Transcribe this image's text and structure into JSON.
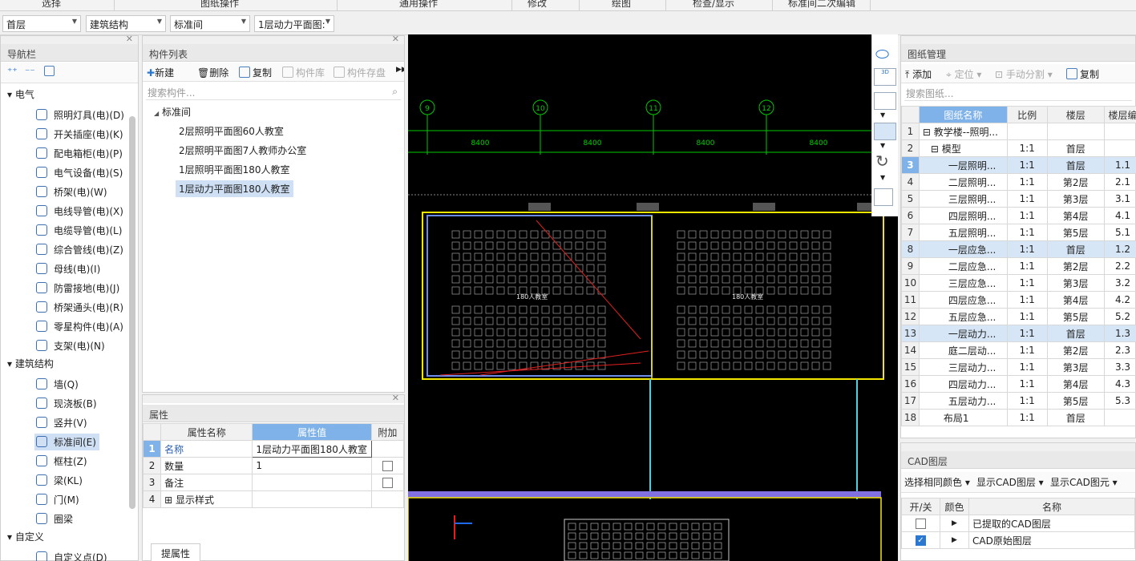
{
  "menubar": [
    "选择",
    "图纸操作",
    "通用操作",
    "修改",
    "绘图",
    "检查/显示",
    "标准间二次编辑"
  ],
  "selectors": [
    "首层",
    "建筑结构",
    "标准间",
    "1层动力平面图:"
  ],
  "nav": {
    "title": "导航栏",
    "groups": [
      {
        "label": "电气",
        "items": [
          "照明灯具(电)(D)",
          "开关插座(电)(K)",
          "配电箱柜(电)(P)",
          "电气设备(电)(S)",
          "桥架(电)(W)",
          "电线导管(电)(X)",
          "电缆导管(电)(L)",
          "综合管线(电)(Z)",
          "母线(电)(I)",
          "防雷接地(电)(J)",
          "桥架通头(电)(R)",
          "零星构件(电)(A)",
          "支架(电)(N)"
        ]
      },
      {
        "label": "建筑结构",
        "items": [
          "墙(Q)",
          "现浇板(B)",
          "竖井(V)",
          "标准间(E)",
          "框柱(Z)",
          "梁(KL)",
          "门(M)",
          "圈梁"
        ]
      },
      {
        "label": "自定义",
        "items": [
          "自定义点(D)"
        ]
      }
    ]
  },
  "components": {
    "title": "构件列表",
    "toolbar": [
      "新建",
      "删除",
      "复制",
      "构件库",
      "构件存盘"
    ],
    "search_placeholder": "搜索构件...",
    "root": "标准间",
    "items": [
      "2层照明平面图60人教室",
      "2层照明平面图7人教师办公室",
      "1层照明平面图180人教室",
      "1层动力平面图180人教室"
    ]
  },
  "properties": {
    "title": "属性",
    "headers": [
      "属性名称",
      "属性值",
      "附加"
    ],
    "rows": [
      {
        "n": "1",
        "name": "名称",
        "value": "1层动力平面图180人教室"
      },
      {
        "n": "2",
        "name": "数量",
        "value": "1"
      },
      {
        "n": "3",
        "name": "备注",
        "value": ""
      },
      {
        "n": "4",
        "name": "显示样式",
        "value": ""
      }
    ],
    "tab": "提属性"
  },
  "canvas": {
    "axes": [
      "9",
      "10",
      "11",
      "12"
    ],
    "dims": [
      "8400",
      "8400",
      "8400",
      "8400"
    ],
    "room_labels": [
      "180人教室",
      "180人教室"
    ]
  },
  "drawings": {
    "title": "图纸管理",
    "toolbar": [
      "添加",
      "定位",
      "手动分割",
      "复制"
    ],
    "search_placeholder": "搜索图纸...",
    "headers": [
      "图纸名称",
      "比例",
      "楼层",
      "楼层编"
    ],
    "rows": [
      {
        "n": "1",
        "name": "教学楼--照明...",
        "scale": "",
        "floor": "",
        "code": ""
      },
      {
        "n": "2",
        "name": "模型",
        "scale": "1:1",
        "floor": "首层",
        "code": ""
      },
      {
        "n": "3",
        "name": "一层照明...",
        "scale": "1:1",
        "floor": "首层",
        "code": "1.1"
      },
      {
        "n": "4",
        "name": "二层照明...",
        "scale": "1:1",
        "floor": "第2层",
        "code": "2.1"
      },
      {
        "n": "5",
        "name": "三层照明...",
        "scale": "1:1",
        "floor": "第3层",
        "code": "3.1"
      },
      {
        "n": "6",
        "name": "四层照明...",
        "scale": "1:1",
        "floor": "第4层",
        "code": "4.1"
      },
      {
        "n": "7",
        "name": "五层照明...",
        "scale": "1:1",
        "floor": "第5层",
        "code": "5.1"
      },
      {
        "n": "8",
        "name": "一层应急...",
        "scale": "1:1",
        "floor": "首层",
        "code": "1.2"
      },
      {
        "n": "9",
        "name": "二层应急...",
        "scale": "1:1",
        "floor": "第2层",
        "code": "2.2"
      },
      {
        "n": "10",
        "name": "三层应急...",
        "scale": "1:1",
        "floor": "第3层",
        "code": "3.2"
      },
      {
        "n": "11",
        "name": "四层应急...",
        "scale": "1:1",
        "floor": "第4层",
        "code": "4.2"
      },
      {
        "n": "12",
        "name": "五层应急...",
        "scale": "1:1",
        "floor": "第5层",
        "code": "5.2"
      },
      {
        "n": "13",
        "name": "一层动力...",
        "scale": "1:1",
        "floor": "首层",
        "code": "1.3"
      },
      {
        "n": "14",
        "name": "庭二层动...",
        "scale": "1:1",
        "floor": "第2层",
        "code": "2.3"
      },
      {
        "n": "15",
        "name": "三层动力...",
        "scale": "1:1",
        "floor": "第3层",
        "code": "3.3"
      },
      {
        "n": "16",
        "name": "四层动力...",
        "scale": "1:1",
        "floor": "第4层",
        "code": "4.3"
      },
      {
        "n": "17",
        "name": "五层动力...",
        "scale": "1:1",
        "floor": "第5层",
        "code": "5.3"
      },
      {
        "n": "18",
        "name": "布局1",
        "scale": "1:1",
        "floor": "首层",
        "code": ""
      }
    ]
  },
  "cad": {
    "title": "CAD图层",
    "toolbar": [
      "选择相同颜色",
      "显示CAD图层",
      "显示CAD图元"
    ],
    "headers": [
      "开/关",
      "颜色",
      "名称"
    ],
    "rows": [
      {
        "name": "已提取的CAD图层",
        "on": false
      },
      {
        "name": "CAD原始图层",
        "on": true
      }
    ]
  },
  "colors": {
    "accent": "#7fb2e8",
    "selected": "#cfe0f5",
    "cad_yellow": "#f5e600",
    "cad_green": "#00e000",
    "cad_cyan": "#4fd0e0"
  }
}
